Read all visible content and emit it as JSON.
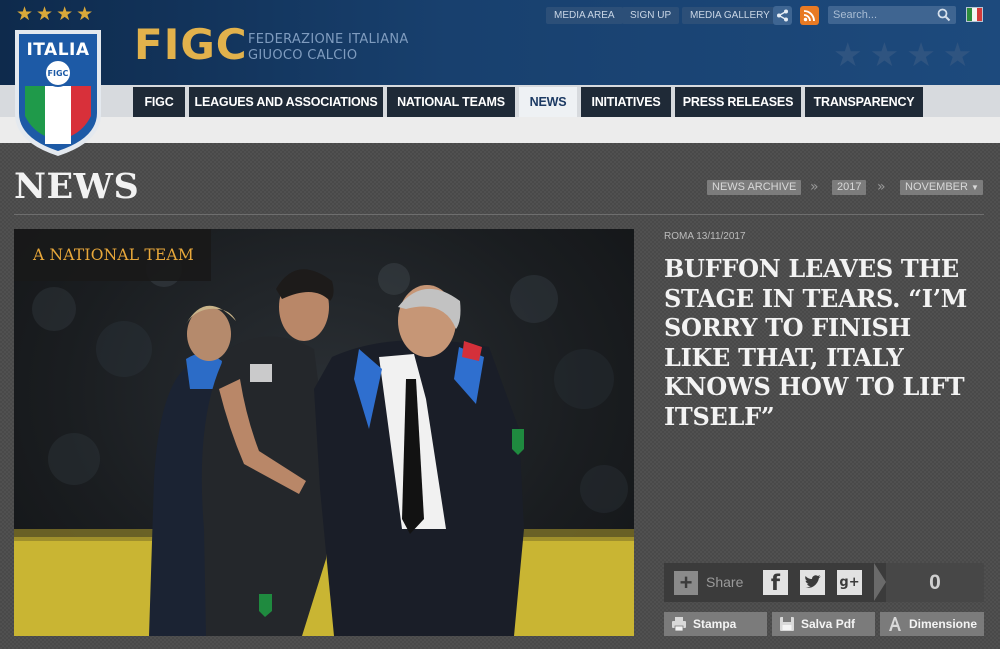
{
  "header": {
    "logo_text": "ITALIA",
    "logo_sub": "FIGC",
    "brand": "FIGC",
    "federation_line1": "FEDERAZIONE ITALIANA",
    "federation_line2": "GIUOCO CALCIO",
    "top_links": [
      "MEDIA AREA",
      "SIGN UP",
      "MEDIA GALLERY"
    ],
    "search_placeholder": "Search...",
    "icons": [
      "share-icon",
      "rss-icon",
      "search-icon",
      "italian-flag-icon"
    ],
    "colors": {
      "gold": "#e2b24c",
      "navy": "#18406e"
    }
  },
  "nav": {
    "items": [
      "FIGC",
      "LEAGUES AND ASSOCIATIONS",
      "NATIONAL TEAMS",
      "NEWS",
      "INITIATIVES",
      "PRESS RELEASES",
      "TRANSPARENCY"
    ],
    "active": "NEWS"
  },
  "page": {
    "title": "NEWS",
    "breadcrumb": [
      "NEWS ARCHIVE",
      "2017",
      "NOVEMBER"
    ]
  },
  "article": {
    "category": "A NATIONAL TEAM",
    "date": "ROMA 13/11/2017",
    "title": "BUFFON LEAVES THE STAGE IN TEARS. “I’M SORRY TO FINISH LIKE THAT, ITALY KNOWS HOW TO LIFT ITSELF”",
    "share_label": "Share",
    "share_count": "0",
    "social": [
      "facebook-icon",
      "twitter-icon",
      "google-plus-icon"
    ],
    "tools": [
      "Stampa",
      "Salva Pdf",
      "Dimensione"
    ]
  }
}
